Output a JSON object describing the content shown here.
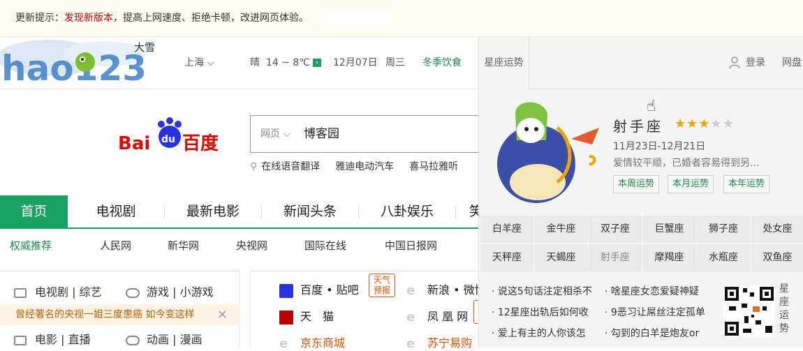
{
  "notice": {
    "prefix": "更新提示：",
    "link": "发现新版本",
    "suffix": "，提高上网速度、拒绝卡顿，改进网页体验。"
  },
  "header": {
    "logo_text": "hao123",
    "snow": "大雪",
    "city": "上海",
    "weather": "晴",
    "temp": "14 ~ 8℃",
    "date": "12月07日",
    "weekday": "周三",
    "tip": "冬季饮食"
  },
  "panel": {
    "tab": "星座运势",
    "login": "登录",
    "netdisk": "网盘"
  },
  "search": {
    "engine": "百度",
    "type": "网页",
    "value": "博客园",
    "hot": [
      "在线语音翻译",
      "雅迪电动汽车",
      "喜马拉雅听"
    ]
  },
  "nav": {
    "tabs": [
      "首页",
      "电视剧",
      "最新电影",
      "新闻头条",
      "八卦娱乐",
      "笑"
    ]
  },
  "auth": {
    "lead": "权威推荐",
    "items": [
      "人民网",
      "新华网",
      "央视网",
      "国际在线",
      "中国日报网"
    ]
  },
  "left": {
    "row1a": "电视剧 | 综艺",
    "row1b": "游戏 | 小游戏",
    "news": "曾经著名的央视一姐三度患癌 如今变这样",
    "close": "×",
    "row3a": "电影 | 直播",
    "row3b": "动画 | 漫画"
  },
  "sites": {
    "a1": "百度 • 贴吧",
    "tag": "天气预报",
    "a2": "新浪 • 微博",
    "b1": "天　猫",
    "b2": "凤 凰 网",
    "c1": "京东商城",
    "c2": "苏宁易购"
  },
  "zodiac": {
    "name": "射手座",
    "stars_on": 3,
    "stars_total": 5,
    "date": "11月23日-12月21日",
    "desc": "爱情较平顺，已婚者容易得到另...",
    "btns": [
      "本周运势",
      "本月运势",
      "本年运势"
    ],
    "signs": [
      "白羊座",
      "金牛座",
      "双子座",
      "巨蟹座",
      "狮子座",
      "处女座",
      "天秤座",
      "天蝎座",
      "射手座",
      "摩羯座",
      "水瓶座",
      "双鱼座"
    ],
    "links": [
      "说这5句话注定相杀不",
      "12星座出轨后如何收",
      "爱上有主的人你该怎",
      "啥星座女恋爱疑神疑",
      "9恶习让屌丝注定孤单",
      "勾到的白羊是炮友or"
    ],
    "qr_label": "星座运势"
  },
  "colors": {
    "green": "#1aa260",
    "orange": "#e64e00",
    "star": "#f0a400"
  }
}
